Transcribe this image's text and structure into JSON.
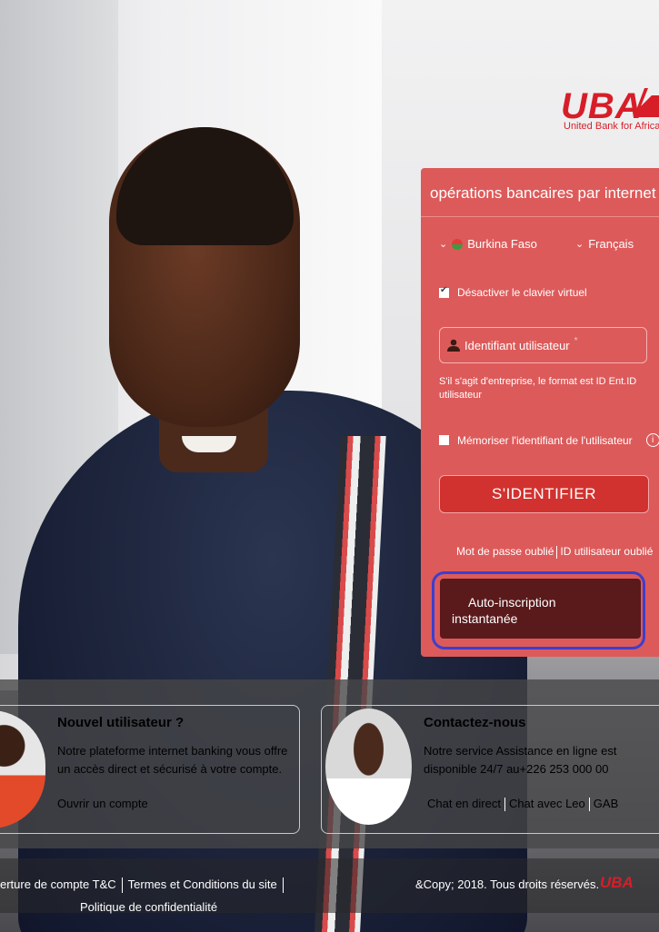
{
  "brand": {
    "logo_text": "UBA",
    "tagline": "United Bank for Africa",
    "color": "#d71e28"
  },
  "login": {
    "title": "opérations bancaires par internet",
    "country": "Burkina Faso",
    "language": "Français",
    "virtual_keyboard_label": "Désactiver le clavier virtuel",
    "virtual_keyboard_checked": true,
    "user_id_placeholder": "Identifiant utilisateur",
    "user_id_hint": "S'il s'agit d'entreprise, le format est ID Ent.ID utilisateur",
    "remember_label": "Mémoriser l'identifiant de l'utilisateur",
    "remember_checked": false,
    "info_glyph": "i",
    "submit_label": "S'IDENTIFIER",
    "forgot_password": "Mot de passe oublié",
    "forgot_user_id": "ID utilisateur oublié",
    "self_register_line1": "Auto-inscription",
    "self_register_line2": "instantanée",
    "panel_color": "#dd5a5a",
    "highlight_color": "#3a3fd0"
  },
  "new_user": {
    "title": "Nouvel utilisateur ?",
    "text": "Notre plateforme internet banking vous offre un accès direct et sécurisé à votre compte.",
    "link": "Ouvrir un compte"
  },
  "contact": {
    "title": "Contactez-nous",
    "text": "Notre service Assistance en ligne est disponible 24/7 au+226 253 000 00",
    "link_chat": "Chat en direct",
    "link_leo": "Chat avec Leo",
    "link_gab": "GAB"
  },
  "footer": {
    "link_account_terms": "erture de compte T&C",
    "link_site_terms": "Termes et Conditions du site",
    "link_privacy": "Politique de confidentialité",
    "copyright": "&Copy; 2018. Tous droits réservés.",
    "logo_text": "UBA"
  }
}
